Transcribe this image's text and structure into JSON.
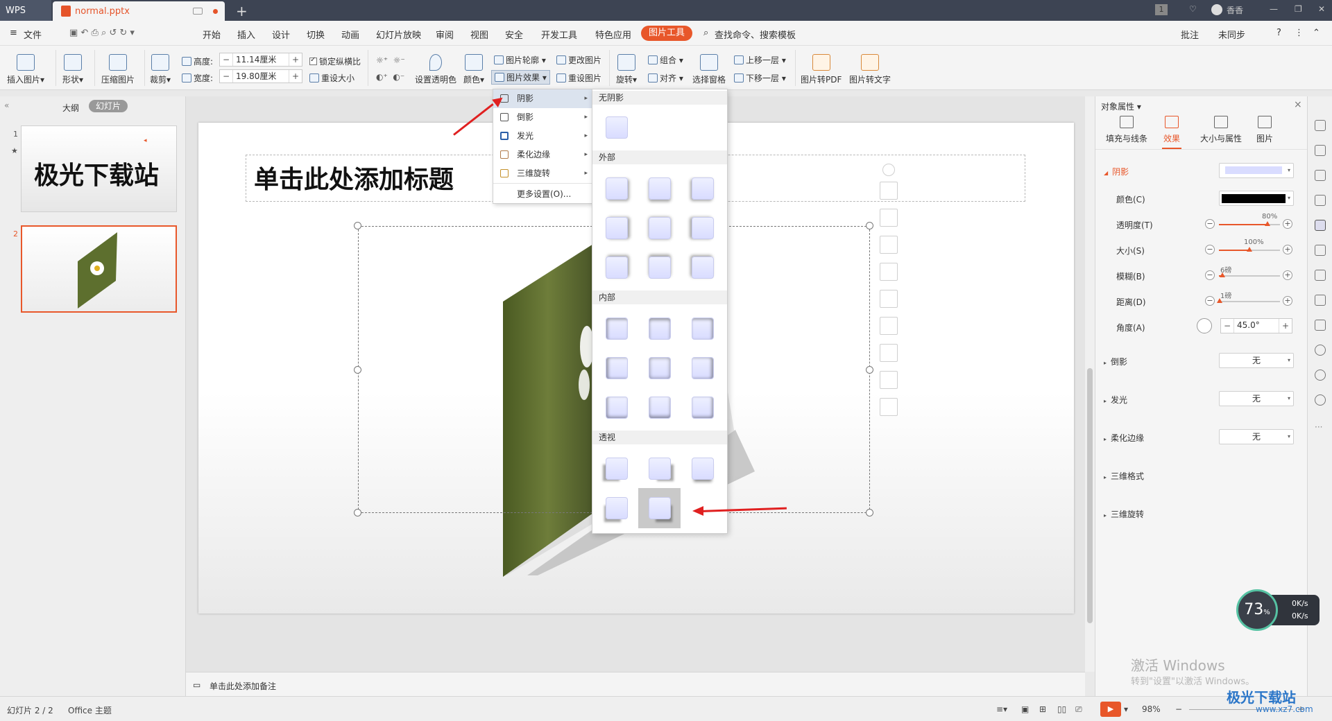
{
  "titlebar": {
    "app_tab": "WPS",
    "file_tab": "normal.pptx",
    "new_tab": "+",
    "right_items": [
      "1",
      "香香"
    ]
  },
  "menubar": {
    "file": "文件",
    "items": [
      "开始",
      "插入",
      "设计",
      "切换",
      "动画",
      "幻灯片放映",
      "审阅",
      "视图",
      "安全",
      "开发工具",
      "特色应用"
    ],
    "active": "图片工具",
    "search": "查找命令、搜索模板",
    "right": [
      "批注",
      "未同步"
    ]
  },
  "ribbon": {
    "insert_pic": "插入图片",
    "shape": "形状",
    "compress": "压缩图片",
    "crop": "裁剪",
    "height_label": "高度:",
    "height_value": "11.14厘米",
    "width_label": "宽度:",
    "width_value": "19.80厘米",
    "lock_ratio": "锁定纵横比",
    "reset_size": "重设大小",
    "set_transparent": "设置透明色",
    "color": "颜色",
    "pic_outline": "图片轮廓",
    "pic_effect": "图片效果",
    "change_pic": "更改图片",
    "reset_pic": "重设图片",
    "rotate": "旋转",
    "group": "组合",
    "align": "对齐",
    "select_pane": "选择窗格",
    "bring_forward": "上移一层",
    "send_backward": "下移一层",
    "pic_to_pdf": "图片转PDF",
    "pic_to_text": "图片转文字"
  },
  "leftpanel": {
    "tab_outline": "大纲",
    "tab_slides": "幻灯片",
    "slide1_num": "1",
    "slide1_title": "极光下载站",
    "slide2_num": "2"
  },
  "slide": {
    "title_placeholder": "单击此处添加标题",
    "notes_placeholder": "单击此处添加备注"
  },
  "effect_menu": {
    "items": [
      "阴影",
      "倒影",
      "发光",
      "柔化边缘",
      "三维旋转"
    ],
    "more": "更多设置(O)..."
  },
  "shadow_gallery": {
    "none": "无阴影",
    "outer": "外部",
    "inner": "内部",
    "perspective": "透视"
  },
  "rightpanel": {
    "title": "对象属性",
    "tabs": [
      "填充与线条",
      "效果",
      "大小与属性",
      "图片"
    ],
    "active_tab": "效果",
    "shadow_section": "阴影",
    "color_label": "颜色(C)",
    "transparency_label": "透明度(T)",
    "transparency_value": "80%",
    "transparency_fraction": 0.8,
    "size_label": "大小(S)",
    "size_value": "100%",
    "size_fraction": 0.5,
    "blur_label": "模糊(B)",
    "blur_value": "6磅",
    "blur_fraction": 0.06,
    "distance_label": "距离(D)",
    "distance_value": "1磅",
    "distance_fraction": 0.01,
    "angle_label": "角度(A)",
    "angle_value": "45.0°",
    "reflection": "倒影",
    "reflection_value": "无",
    "glow": "发光",
    "glow_value": "无",
    "soft_edge": "柔化边缘",
    "soft_edge_value": "无",
    "format3d": "三维格式",
    "rotation3d": "三维旋转"
  },
  "statusbar": {
    "slide_info": "幻灯片 2 / 2",
    "theme": "Office 主题",
    "zoom": "98%"
  },
  "speed_widget": {
    "percent": "73",
    "up": "0K/s",
    "down": "0K/s"
  },
  "watermark": {
    "line1": "激活 Windows",
    "line2": "转到\"设置\"以激活 Windows。",
    "logo": "极光下载站",
    "url": "www.xz7.com"
  },
  "colors": {
    "accent": "#e8572a",
    "titlebar": "#3d4453",
    "selected_menu": "#dbe3ee"
  }
}
